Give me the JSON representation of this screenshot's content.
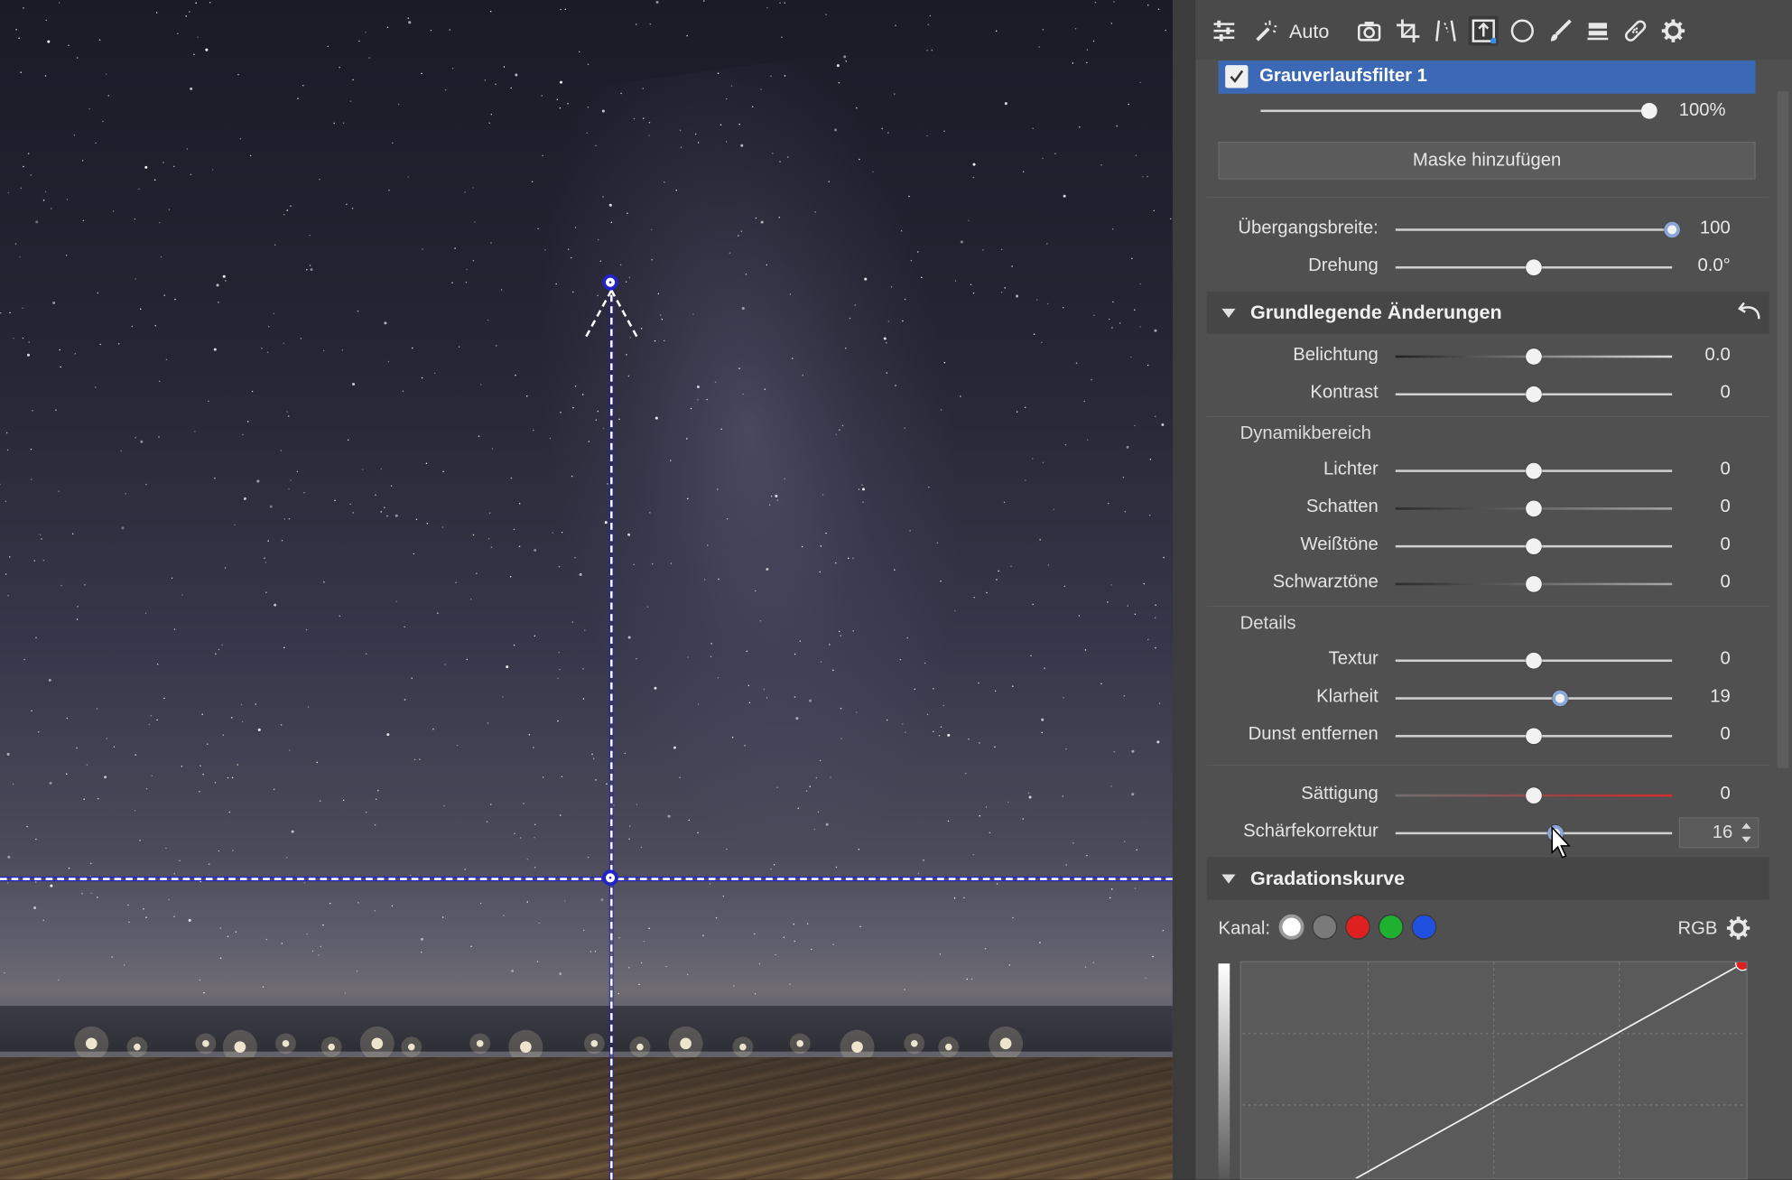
{
  "colors": {
    "panel_bg": "#505050",
    "accent": "#3b69b5",
    "guide_blue": "#2323c8",
    "saturation_red": "#d42c2c"
  },
  "toolbar": {
    "auto_label": "Auto",
    "icons": [
      "sliders-icon",
      "magic-wand-icon",
      "camera-icon",
      "crop-icon",
      "perspective-icon",
      "gradient-filter-icon",
      "radial-filter-icon",
      "brush-icon",
      "eraser-icon",
      "healing-icon",
      "gear-icon"
    ],
    "active_icon": "gradient-filter-icon"
  },
  "filter": {
    "name": "Grauverlaufsfilter 1",
    "enabled": true,
    "opacity_label": "100%",
    "opacity_fraction": 1.0
  },
  "mask_button_label": "Maske hinzufügen",
  "transition": [
    {
      "label": "Übergangsbreite:",
      "value": "100",
      "fraction": 1.0
    },
    {
      "label": "Drehung",
      "value": "0.0°",
      "fraction": 0.5
    }
  ],
  "basic": {
    "title": "Grundlegende Änderungen",
    "reset_icon": "undo-icon",
    "exposure": [
      {
        "label": "Belichtung",
        "value": "0.0",
        "fraction": 0.5
      },
      {
        "label": "Kontrast",
        "value": "0",
        "fraction": 0.5
      }
    ],
    "dynamic_title": "Dynamikbereich",
    "dynamic": [
      {
        "label": "Lichter",
        "value": "0",
        "fraction": 0.5
      },
      {
        "label": "Schatten",
        "value": "0",
        "fraction": 0.5
      },
      {
        "label": "Weißtöne",
        "value": "0",
        "fraction": 0.5
      },
      {
        "label": "Schwarztöne",
        "value": "0",
        "fraction": 0.5
      }
    ],
    "details_title": "Details",
    "details": [
      {
        "label": "Textur",
        "value": "0",
        "fraction": 0.5
      },
      {
        "label": "Klarheit",
        "value": "19",
        "fraction": 0.595
      },
      {
        "label": "Dunst entfernen",
        "value": "0",
        "fraction": 0.5
      }
    ],
    "saturation": {
      "label": "Sättigung",
      "value": "0",
      "fraction": 0.5
    },
    "sharpness": {
      "label": "Schärfekorrektur",
      "value": "16",
      "fraction": 0.58
    }
  },
  "curve": {
    "title": "Gradationskurve",
    "channel_label": "Kanal:",
    "channels": [
      {
        "name": "white",
        "color": "#ffffff"
      },
      {
        "name": "gray",
        "color": "#7a7a7a"
      },
      {
        "name": "red",
        "color": "#e02020"
      },
      {
        "name": "green",
        "color": "#20b030"
      },
      {
        "name": "blue",
        "color": "#2050e0"
      }
    ],
    "mode_label": "RGB"
  }
}
